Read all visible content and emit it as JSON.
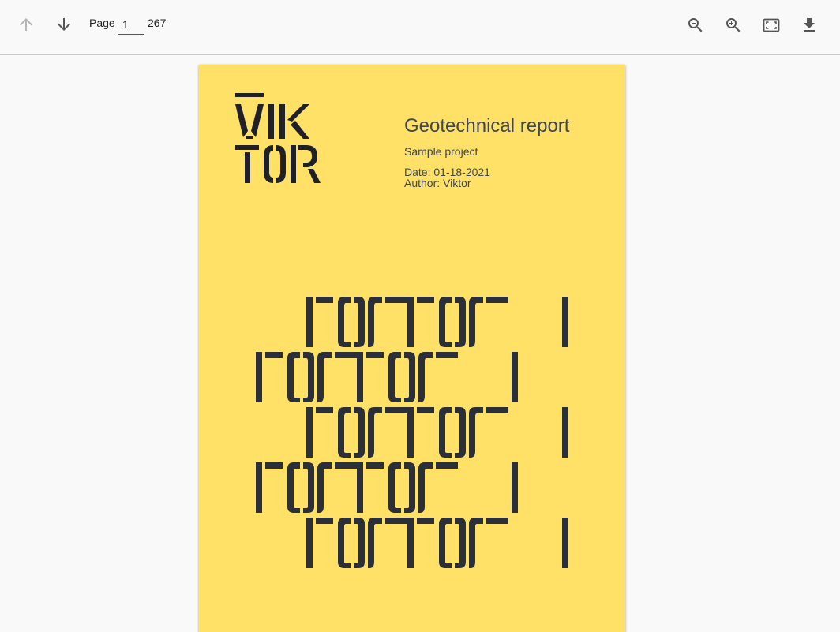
{
  "toolbar": {
    "prev_icon": "arrow-up-icon",
    "next_icon": "arrow-down-icon",
    "page_label": "Page",
    "page_current": "1",
    "page_total": "267",
    "zoom_out_icon": "zoom-out-icon",
    "zoom_in_icon": "zoom-in-icon",
    "fit_icon": "fit-screen-icon",
    "download_icon": "download-icon"
  },
  "document": {
    "logo_text": "VIKTOR",
    "title": "Geotechnical report",
    "subtitle": "Sample project",
    "date": "Date: 01-18-2021",
    "author": "Author: Viktor"
  },
  "colors": {
    "page_background": "#ffe168",
    "ink": "#2b2f38",
    "text": "#3f4654",
    "toolbar_icon": "#555555",
    "toolbar_icon_disabled": "#b5b5b5"
  }
}
